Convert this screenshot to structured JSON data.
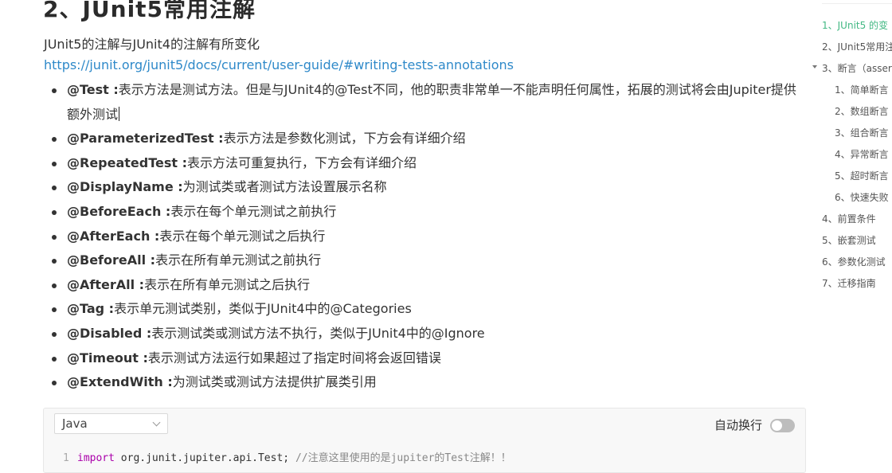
{
  "article": {
    "title": "2、JUnit5常用注解",
    "intro": "JUnit5的注解与JUnit4的注解有所变化",
    "link": "https://junit.org/junit5/docs/current/user-guide/#writing-tests-annotations",
    "annotations": [
      {
        "name": "@Test :",
        "desc": "表示方法是测试方法。但是与JUnit4的@Test不同，他的职责非常单一不能声明任何属性，拓展的测试将会由Jupiter提供额外测试"
      },
      {
        "name": "@ParameterizedTest :",
        "desc": "表示方法是参数化测试，下方会有详细介绍"
      },
      {
        "name": "@RepeatedTest :",
        "desc": "表示方法可重复执行，下方会有详细介绍"
      },
      {
        "name": "@DisplayName :",
        "desc": "为测试类或者测试方法设置展示名称"
      },
      {
        "name": "@BeforeEach :",
        "desc": "表示在每个单元测试之前执行"
      },
      {
        "name": "@AfterEach :",
        "desc": "表示在每个单元测试之后执行"
      },
      {
        "name": "@BeforeAll :",
        "desc": "表示在所有单元测试之前执行"
      },
      {
        "name": "@AfterAll :",
        "desc": "表示在所有单元测试之后执行"
      },
      {
        "name": "@Tag :",
        "desc": "表示单元测试类别，类似于JUnit4中的@Categories"
      },
      {
        "name": "@Disabled :",
        "desc": "表示测试类或测试方法不执行，类似于JUnit4中的@Ignore"
      },
      {
        "name": "@Timeout :",
        "desc": "表示测试方法运行如果超过了指定时间将会返回错误"
      },
      {
        "name": "@ExtendWith :",
        "desc": "为测试类或测试方法提供扩展类引用"
      }
    ]
  },
  "code_block": {
    "language": "Java",
    "wrap_label": "自动换行",
    "wrap_enabled": false,
    "line_number": "1",
    "keyword": "import",
    "statement": " org.junit.jupiter.api.Test; ",
    "comment": "//注意这里使用的是jupiter的Test注解！！"
  },
  "toc": {
    "items": [
      {
        "label": "1、JUnit5 的变",
        "active": true
      },
      {
        "label": "2、JUnit5常用注",
        "active": false
      },
      {
        "label": "3、断言（asser",
        "active": false,
        "expanded": true
      },
      {
        "label": "1、简单断言",
        "active": false
      },
      {
        "label": "2、数组断言",
        "active": false
      },
      {
        "label": "3、组合断言",
        "active": false
      },
      {
        "label": "4、异常断言",
        "active": false
      },
      {
        "label": "5、超时断言",
        "active": false
      },
      {
        "label": "6、快速失败",
        "active": false
      },
      {
        "label": "4、前置条件",
        "active": false
      },
      {
        "label": "5、嵌套测试",
        "active": false
      },
      {
        "label": "6、参数化测试",
        "active": false
      },
      {
        "label": "7、迁移指南",
        "active": false
      }
    ]
  },
  "colors": {
    "link": "#2e89c9",
    "toc_active": "#42b883",
    "code_keyword": "#aa00aa"
  }
}
